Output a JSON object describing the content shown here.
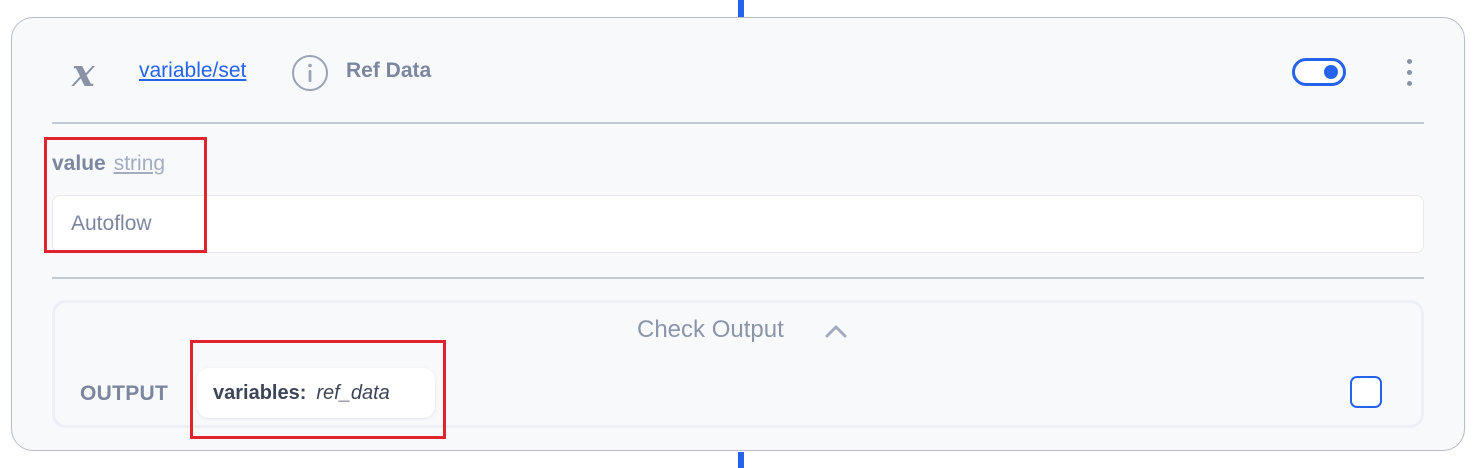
{
  "node": {
    "icon": "variable-x-icon",
    "link_text": "variable/set",
    "info_icon": "info-icon",
    "label": "Ref Data",
    "enabled": true,
    "menu_icon": "kebab-menu-icon"
  },
  "param": {
    "name": "value",
    "type": "string",
    "value": "Autoflow"
  },
  "output": {
    "toggle_label": "Check Output",
    "toggle_icon": "chevron-up-icon",
    "label": "OUTPUT",
    "chip_key": "variables:",
    "chip_value": "ref_data",
    "checkbox_checked": false
  },
  "colors": {
    "accent": "#2563eb",
    "highlight": "#e0242f",
    "muted_text": "#7c879f",
    "card_border": "#b4bccd"
  }
}
